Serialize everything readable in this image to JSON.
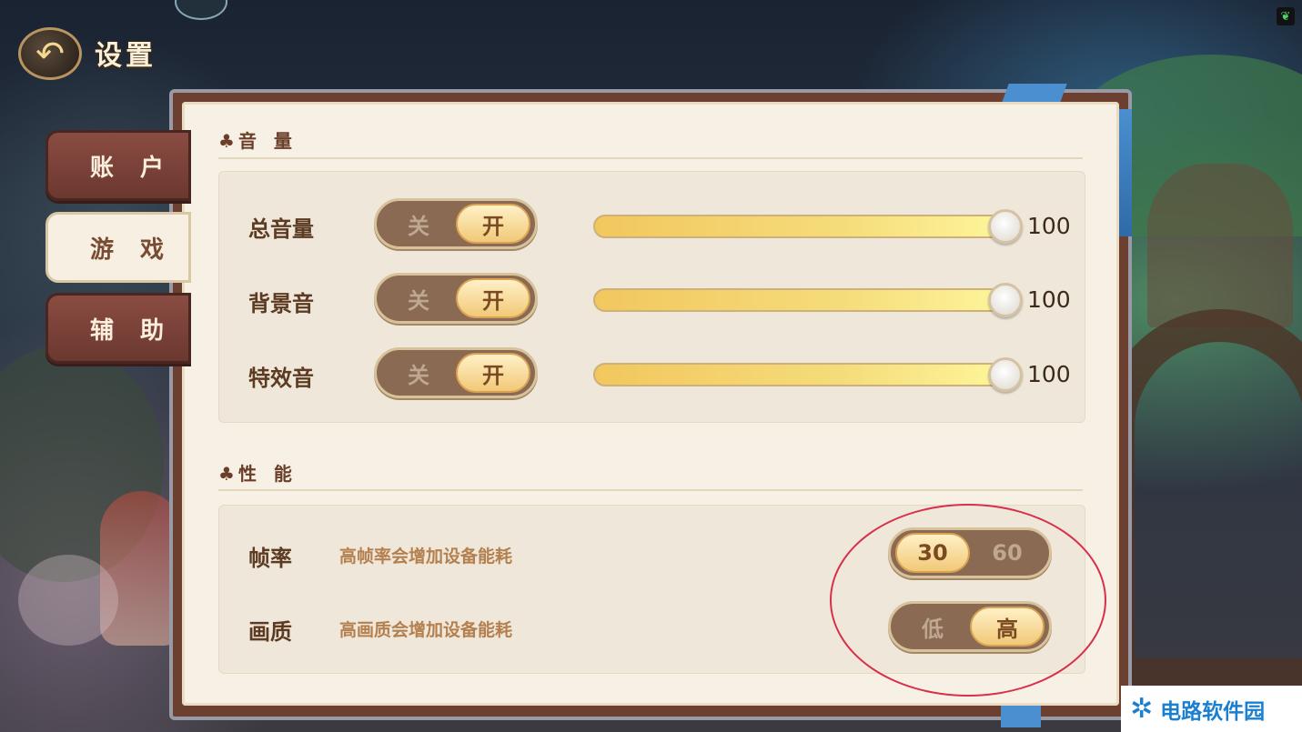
{
  "header": {
    "title": "设置",
    "back_icon": "back-arrow-icon"
  },
  "tabs": [
    {
      "label": "账 户",
      "state": "inactive"
    },
    {
      "label": "游 戏",
      "state": "active"
    },
    {
      "label": "辅 助",
      "state": "inactive"
    }
  ],
  "volume": {
    "section_title": "音 量",
    "section_icon": "club-icon",
    "rows": [
      {
        "label": "总音量",
        "toggle": {
          "off_label": "关",
          "on_label": "开",
          "selected": "开"
        },
        "value": "100",
        "level": 1.0
      },
      {
        "label": "背景音",
        "toggle": {
          "off_label": "关",
          "on_label": "开",
          "selected": "开"
        },
        "value": "100",
        "level": 1.0
      },
      {
        "label": "特效音",
        "toggle": {
          "off_label": "关",
          "on_label": "开",
          "selected": "开"
        },
        "value": "100",
        "level": 1.0
      }
    ]
  },
  "performance": {
    "section_title": "性 能",
    "section_icon": "club-icon",
    "rows": [
      {
        "label": "帧率",
        "desc": "高帧率会增加设备能耗",
        "toggle": {
          "left_label": "30",
          "right_label": "60",
          "selected": "30"
        }
      },
      {
        "label": "画质",
        "desc": "高画质会增加设备能耗",
        "toggle": {
          "left_label": "低",
          "right_label": "高",
          "selected": "高"
        }
      }
    ]
  },
  "watermark": {
    "text": "电路软件园"
  },
  "colors": {
    "accent_gold": "#f1c978",
    "panel_bg": "#f7f1e5",
    "tab_inactive": "#8a4c42",
    "highlight": "#d8304a"
  }
}
